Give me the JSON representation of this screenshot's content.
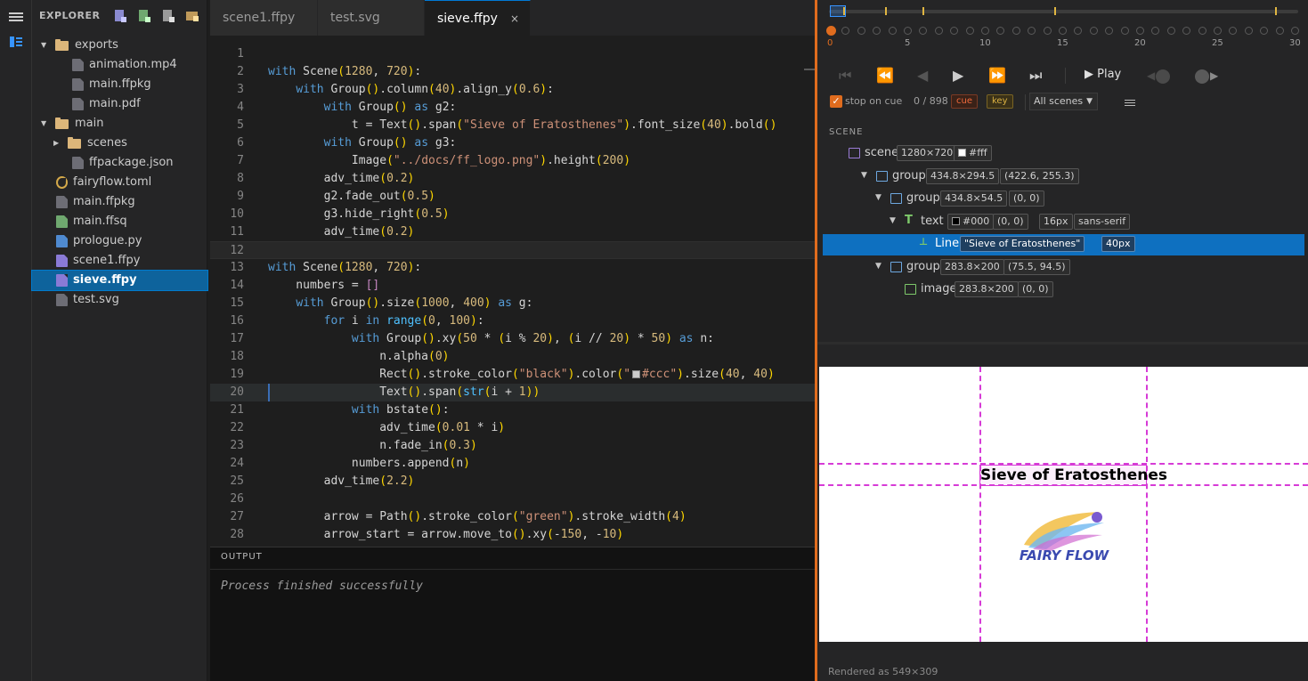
{
  "explorer": {
    "title": "EXPLORER",
    "tools": [
      "new-file-icon",
      "new-ffpkg-icon",
      "new-script-icon",
      "new-folder-icon"
    ],
    "items": [
      {
        "label": "exports",
        "type": "folder",
        "expanded": true,
        "depth": 0
      },
      {
        "label": "animation.mp4",
        "type": "file",
        "depth": 1
      },
      {
        "label": "main.ffpkg",
        "type": "file",
        "depth": 1
      },
      {
        "label": "main.pdf",
        "type": "file",
        "depth": 1
      },
      {
        "label": "main",
        "type": "folder",
        "expanded": true,
        "depth": 0
      },
      {
        "label": "scenes",
        "type": "folder",
        "expanded": false,
        "depth": 1
      },
      {
        "label": "ffpackage.json",
        "type": "file",
        "depth": 1
      },
      {
        "label": "fairyflow.toml",
        "type": "toml",
        "depth": 0
      },
      {
        "label": "main.ffpkg",
        "type": "file",
        "depth": 0
      },
      {
        "label": "main.ffsq",
        "type": "ffsq",
        "depth": 0
      },
      {
        "label": "prologue.py",
        "type": "py",
        "depth": 0
      },
      {
        "label": "scene1.ffpy",
        "type": "ffpy",
        "depth": 0
      },
      {
        "label": "sieve.ffpy",
        "type": "ffpy",
        "depth": 0,
        "selected": true
      },
      {
        "label": "test.svg",
        "type": "file",
        "depth": 0
      }
    ]
  },
  "tabs": [
    {
      "label": "scene1.ffpy"
    },
    {
      "label": "test.svg"
    },
    {
      "label": "sieve.ffpy",
      "active": true,
      "close": "×"
    }
  ],
  "code": {
    "lines": [
      "",
      "with Scene(1280, 720):",
      "    with Group().column(40).align_y(0.6):",
      "        with Group() as g2:",
      "            t = Text().span(\"Sieve of Eratosthenes\").font_size(40).bold()",
      "        with Group() as g3:",
      "            Image(\"../docs/ff_logo.png\").height(200)",
      "        adv_time(0.2)",
      "        g2.fade_out(0.5)",
      "        g3.hide_right(0.5)",
      "        adv_time(0.2)",
      "",
      "with Scene(1280, 720):",
      "    numbers = []",
      "    with Group().size(1000, 400) as g:",
      "        for i in range(0, 100):",
      "            with Group().xy(50 * (i % 20), (i // 20) * 50) as n:",
      "                n.alpha(0)",
      "                Rect().stroke_color(\"black\").color(\"#ccc\").size(40, 40)",
      "                Text().span(str(i + 1))",
      "            with bstate():",
      "                adv_time(0.01 * i)",
      "                n.fade_in(0.3)",
      "            numbers.append(n)",
      "        adv_time(2.2)",
      "",
      "        arrow = Path().stroke_color(\"green\").stroke_width(4)",
      "        arrow_start = arrow.move_to().xy(-150, -10)"
    ],
    "current_line": 12,
    "cursor_line": 20
  },
  "output": {
    "title": "OUTPUT",
    "message": "Process finished successfully"
  },
  "timeline": {
    "tick_labels": [
      "0",
      "5",
      "10",
      "15",
      "20",
      "25",
      "30"
    ],
    "frame_count": 31,
    "current_frame": 0,
    "cue_marks": [
      0.0,
      0.03,
      0.12,
      0.2,
      0.48,
      0.95
    ],
    "play_label": "▶ Play",
    "stop_on_cue": true,
    "stop_on_cue_label": "stop on cue",
    "frames_text": "0 / 898",
    "cue_label": "cue",
    "key_label": "key",
    "scene_select": "All scenes"
  },
  "scene_tree": {
    "title": "SCENE",
    "rows": [
      {
        "name": "scene",
        "icon": "scene-icon",
        "depth": 0,
        "twisty": "",
        "tags": [
          "1280×720",
          "#fff"
        ]
      },
      {
        "name": "group",
        "icon": "folder-icon",
        "depth": 1,
        "twisty": "▼",
        "tags": [
          "434.8×294.5",
          "(422.6, 255.3)"
        ]
      },
      {
        "name": "group",
        "icon": "folder-icon",
        "depth": 2,
        "twisty": "▼",
        "tags": [
          "434.8×54.5",
          "(0, 0)"
        ]
      },
      {
        "name": "text",
        "icon": "text-icon",
        "depth": 3,
        "twisty": "▼",
        "tags": [
          "#000",
          "(0, 0)",
          "16px",
          "sans-serif"
        ]
      },
      {
        "name": "Line",
        "icon": "line-icon",
        "depth": 4,
        "twisty": "",
        "selected": true,
        "tags": [
          "\"Sieve of Eratosthenes\"",
          "40px"
        ]
      },
      {
        "name": "group",
        "icon": "folder-icon",
        "depth": 2,
        "twisty": "▼",
        "tags": [
          "283.8×200",
          "(75.5, 94.5)"
        ]
      },
      {
        "name": "image",
        "icon": "image-icon",
        "depth": 3,
        "twisty": "",
        "tags": [
          "283.8×200",
          "(0, 0)"
        ]
      }
    ]
  },
  "preview": {
    "title_text": "Sieve of Eratosthenes",
    "logo_text": "FAIRY FLOW",
    "status": "Rendered as 549×309"
  }
}
